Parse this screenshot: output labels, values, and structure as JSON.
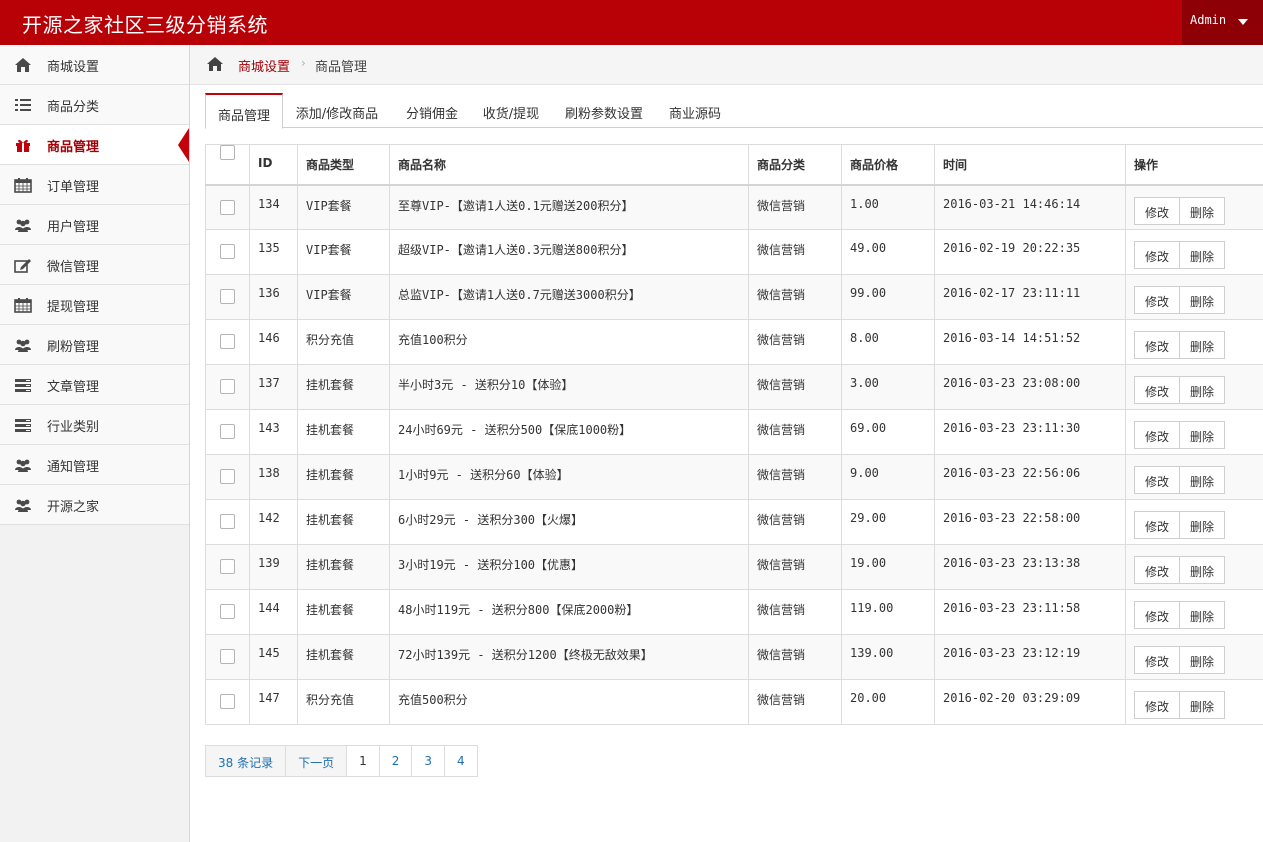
{
  "app": {
    "title": "开源之家社区三级分销系统",
    "user": "Admin"
  },
  "sidebar": {
    "items": [
      {
        "label": "商城设置",
        "icon": "home-icon",
        "active": false
      },
      {
        "label": "商品分类",
        "icon": "list-icon",
        "active": false
      },
      {
        "label": "商品管理",
        "icon": "gift-icon",
        "active": true
      },
      {
        "label": "订单管理",
        "icon": "calendar-icon",
        "active": false
      },
      {
        "label": "用户管理",
        "icon": "users-icon",
        "active": false
      },
      {
        "label": "微信管理",
        "icon": "edit-icon",
        "active": false
      },
      {
        "label": "提现管理",
        "icon": "calendar-icon",
        "active": false
      },
      {
        "label": "刷粉管理",
        "icon": "users-icon",
        "active": false
      },
      {
        "label": "文章管理",
        "icon": "server-icon",
        "active": false
      },
      {
        "label": "行业类别",
        "icon": "server-icon",
        "active": false
      },
      {
        "label": "通知管理",
        "icon": "users-icon",
        "active": false
      },
      {
        "label": "开源之家",
        "icon": "users-icon",
        "active": false
      }
    ]
  },
  "breadcrumb": {
    "parent": "商城设置",
    "separator": "›",
    "current": "商品管理"
  },
  "tabs": [
    {
      "label": "商品管理",
      "active": true
    },
    {
      "label": "添加/修改商品",
      "active": false
    },
    {
      "label": "分销佣金",
      "active": false
    },
    {
      "label": "收货/提现",
      "active": false
    },
    {
      "label": "刷粉参数设置",
      "active": false
    },
    {
      "label": "商业源码",
      "active": false
    }
  ],
  "table": {
    "columns": [
      "ID",
      "商品类型",
      "商品名称",
      "商品分类",
      "商品价格",
      "时间",
      "操作"
    ],
    "edit_label": "修改",
    "delete_label": "删除",
    "rows": [
      {
        "id": "134",
        "type": "VIP套餐",
        "name": "至尊VIP-【邀请1人送0.1元赠送200积分】",
        "category": "微信营销",
        "price": "1.00",
        "time": "2016-03-21 14:46:14"
      },
      {
        "id": "135",
        "type": "VIP套餐",
        "name": "超级VIP-【邀请1人送0.3元赠送800积分】",
        "category": "微信营销",
        "price": "49.00",
        "time": "2016-02-19 20:22:35"
      },
      {
        "id": "136",
        "type": "VIP套餐",
        "name": "总监VIP-【邀请1人送0.7元赠送3000积分】",
        "category": "微信营销",
        "price": "99.00",
        "time": "2016-02-17 23:11:11"
      },
      {
        "id": "146",
        "type": "积分充值",
        "name": "充值100积分",
        "category": "微信营销",
        "price": "8.00",
        "time": "2016-03-14 14:51:52"
      },
      {
        "id": "137",
        "type": "挂机套餐",
        "name": "半小时3元 - 送积分10【体验】",
        "category": "微信营销",
        "price": "3.00",
        "time": "2016-03-23 23:08:00"
      },
      {
        "id": "143",
        "type": "挂机套餐",
        "name": "24小时69元 - 送积分500【保底1000粉】",
        "category": "微信营销",
        "price": "69.00",
        "time": "2016-03-23 23:11:30"
      },
      {
        "id": "138",
        "type": "挂机套餐",
        "name": "1小时9元 - 送积分60【体验】",
        "category": "微信营销",
        "price": "9.00",
        "time": "2016-03-23 22:56:06"
      },
      {
        "id": "142",
        "type": "挂机套餐",
        "name": "6小时29元 - 送积分300【火爆】",
        "category": "微信营销",
        "price": "29.00",
        "time": "2016-03-23 22:58:00"
      },
      {
        "id": "139",
        "type": "挂机套餐",
        "name": "3小时19元 - 送积分100【优惠】",
        "category": "微信营销",
        "price": "19.00",
        "time": "2016-03-23 23:13:38"
      },
      {
        "id": "144",
        "type": "挂机套餐",
        "name": "48小时119元 - 送积分800【保底2000粉】",
        "category": "微信营销",
        "price": "119.00",
        "time": "2016-03-23 23:11:58"
      },
      {
        "id": "145",
        "type": "挂机套餐",
        "name": "72小时139元 - 送积分1200【终极无敌效果】",
        "category": "微信营销",
        "price": "139.00",
        "time": "2016-03-23 23:12:19"
      },
      {
        "id": "147",
        "type": "积分充值",
        "name": "充值500积分",
        "category": "微信营销",
        "price": "20.00",
        "time": "2016-02-20 03:29:09"
      }
    ]
  },
  "pagination": {
    "total": "38 条记录",
    "next": "下一页",
    "pages": [
      "1",
      "2",
      "3",
      "4"
    ],
    "current": "1"
  },
  "colors": {
    "brand": "#b80007",
    "brand_dark": "#8c0006",
    "link": "#1f6fb0"
  }
}
